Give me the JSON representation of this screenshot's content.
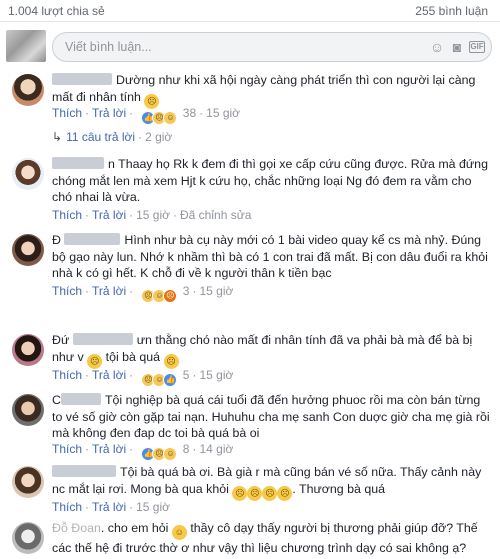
{
  "top": {
    "shares": "1.004 lượt chia sẻ",
    "comments": "255 bình luận"
  },
  "composer": {
    "placeholder": "Viết bình luận..."
  },
  "icons": {
    "emoji": "smiley-icon",
    "camera": "camera-icon",
    "gif": "gif-icon",
    "sticker": "sticker-icon"
  },
  "actions": {
    "like": "Thích",
    "reply": "Trả lời",
    "sep": "·"
  },
  "comments": [
    {
      "name_visible": "",
      "text": "Dường như khi xã hội ngày càng phát triển thì con người lại càng mất đi nhân tính",
      "reaction_count": "38",
      "time": "15 giờ",
      "replies": {
        "label": "11 câu trả lời",
        "time": "2 giờ"
      }
    },
    {
      "name_visible": "n",
      "text": "Thaay họ Rk k đem đi thì gọi xe cấp cứu cũng được. Rửa mà đứng chóng mắt len mà xem Hjt k cứu họ, chắc những loại Ng đó đem ra vằm cho chó nhai là vừa.",
      "time": "15 giờ",
      "edited": "Đã chỉnh sửa"
    },
    {
      "name_visible": "Đ",
      "text": "Hình như bà cụ này mới có 1 bài video quay kể cs mà nhỷ. Đúng bộ gạo này lun. Nhớ k nhầm thì bà có 1 con trai đã mất. Bị con dâu đuổi ra khỏi nhà k có gì hết. K chỗ đi về k người thân k tiền bạc",
      "reaction_count": "3",
      "time": "15 giờ"
    },
    {
      "name_visible": "Đứ",
      "text": "ưn thằng chó nào mất đi nhân tính đã va phải bà mà để bà bị như v",
      "text_after": "tội bà quá",
      "reaction_count": "5",
      "time": "15 giờ"
    },
    {
      "name_visible": "C",
      "text": "Tội nghiệp bà quá cái tuổi đã đến hưởng phuoc rồi ma còn bán từng to vé số giờ còn gặp tai nạn. Huhuhu cha mẹ sanh Con duợc giờ cha mẹ già rồi mà không đen đap dc toi bà quá bà oi",
      "reaction_count": "8",
      "time": "14 giờ"
    },
    {
      "name_visible": "",
      "text": "Tội bà quá bà ơi. Bà già r mà cũng bán vé số nữa. Thấy cảnh này nc mắt lại rơi. Mong bà qua khỏi",
      "text_after": "Thương bà quá",
      "time": "15 giờ"
    },
    {
      "name_visible": "Đỗ Đoan",
      "text": ". cho em hỏi",
      "text_after": "thầy cô dạy thấy người bị thương phải giúp đỡ? Thế các thế hệ đi trước thờ ơ như vậy thì liệu chương trình dạy có sai không ạ?"
    }
  ]
}
